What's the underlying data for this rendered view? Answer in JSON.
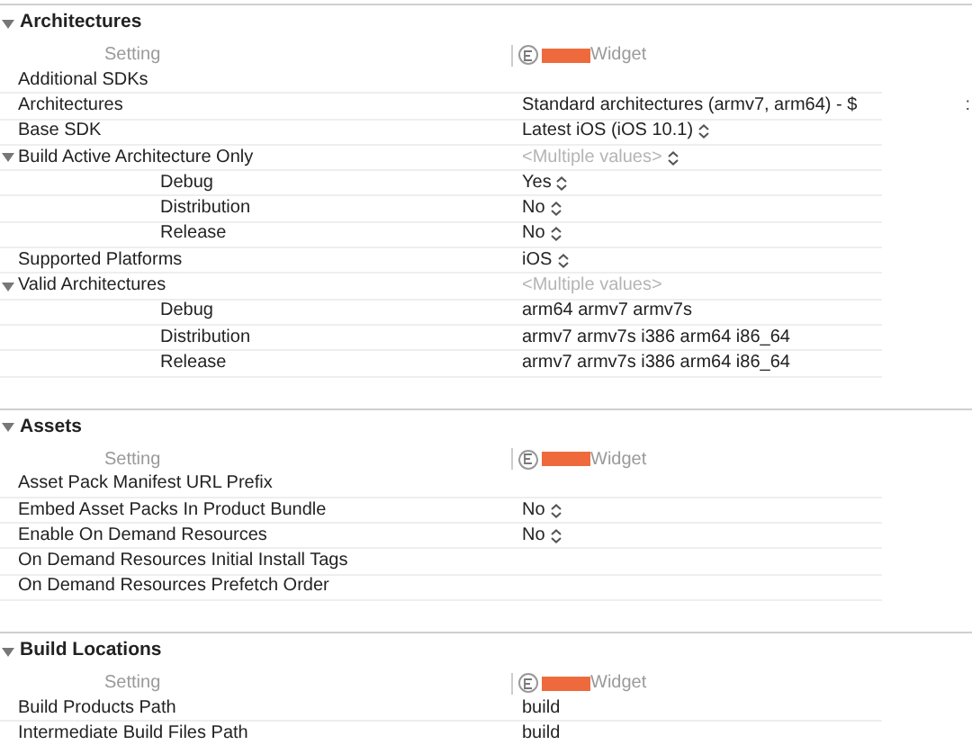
{
  "sections": [
    {
      "title": "Architectures",
      "expanded": true,
      "column_label": "Setting",
      "target": "Widget",
      "rows": [
        {
          "label": "Additional SDKs"
        },
        {
          "label": "Architectures",
          "value": "Standard architectures (armv7, arm64)  -  $",
          "extra": ":"
        },
        {
          "label": "Base SDK",
          "value": "Latest iOS (iOS 10.1)",
          "popup": true
        },
        {
          "label": "Build Active Architecture Only",
          "value": "<Multiple values>",
          "popup": true,
          "dimmed": true,
          "expanded": true,
          "children": [
            {
              "label": "Debug",
              "value": "Yes",
              "popup": true
            },
            {
              "label": "Distribution",
              "value": "No",
              "popup": true
            },
            {
              "label": "Release",
              "value": "No",
              "popup": true
            }
          ]
        },
        {
          "label": "Supported Platforms",
          "value": "iOS",
          "popup": true
        },
        {
          "label": "Valid Architectures",
          "value": "<Multiple values>",
          "dimmed": true,
          "expanded": true,
          "children": [
            {
              "label": "Debug",
              "value": "arm64 armv7 armv7s"
            },
            {
              "label": "Distribution",
              "value": "armv7 armv7s i386 arm64 i86_64"
            },
            {
              "label": "Release",
              "value": "armv7 armv7s i386 arm64 i86_64"
            }
          ]
        }
      ]
    },
    {
      "title": "Assets",
      "expanded": true,
      "column_label": "Setting",
      "target": "Widget",
      "rows": [
        {
          "label": "Asset Pack Manifest URL Prefix"
        },
        {
          "label": "Embed Asset Packs In Product Bundle",
          "value": "No",
          "popup": true
        },
        {
          "label": "Enable On Demand Resources",
          "value": "No",
          "popup": true
        },
        {
          "label": "On Demand Resources Initial Install Tags"
        },
        {
          "label": "On Demand Resources Prefetch Order"
        }
      ]
    },
    {
      "title": "Build Locations",
      "expanded": true,
      "column_label": "Setting",
      "target": "Widget",
      "rows": [
        {
          "label": "Build Products Path",
          "value": "build"
        },
        {
          "label": "Intermediate Build Files Path",
          "value": "build"
        }
      ]
    }
  ]
}
